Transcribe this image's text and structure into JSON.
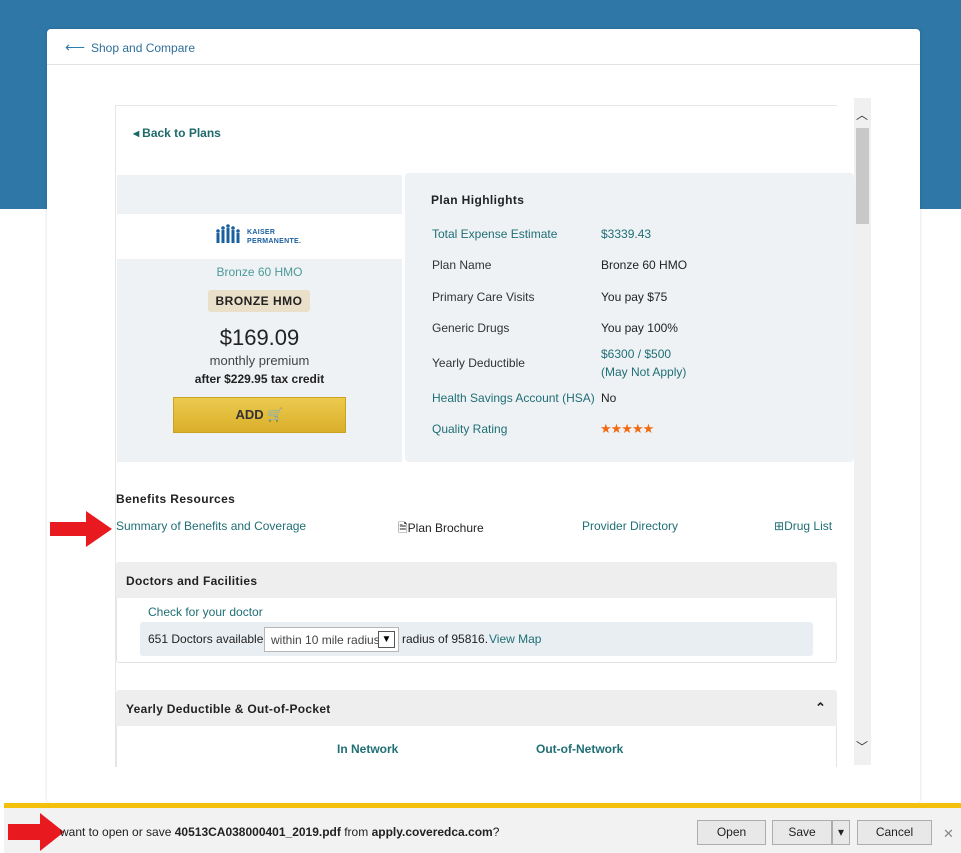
{
  "header": {
    "back_link": "Shop and Compare"
  },
  "plan": {
    "back_to_plans": "Back to Plans",
    "carrier_logo_text": "KAISER PERMANENTE",
    "carrier_logo_line1": "KAISER",
    "carrier_logo_line2": "PERMANENTE.",
    "name": "Bronze 60 HMO",
    "badge": "BRONZE HMO",
    "price": "$169.09",
    "premium_label": "monthly premium",
    "credit": "after $229.95 tax credit",
    "add_label": "ADD"
  },
  "highlights": {
    "title": "Plan Highlights",
    "rows": [
      {
        "label": "Total Expense Estimate",
        "value": "$3339.43"
      },
      {
        "label": "Plan Name",
        "value": "Bronze 60 HMO"
      },
      {
        "label": "Primary Care Visits",
        "value": "You pay $75"
      },
      {
        "label": "Generic Drugs",
        "value": "You pay 100%"
      },
      {
        "label": "Yearly Deductible",
        "value": "$6300 / $500",
        "value2": "(May Not Apply)"
      },
      {
        "label": "Health Savings Account (HSA)",
        "value": "No"
      },
      {
        "label": "Quality Rating",
        "value": "5 stars",
        "rating": 5
      }
    ]
  },
  "benefits": {
    "title": "Benefits Resources",
    "summary": "Summary of Benefits and Coverage",
    "brochure": "Plan Brochure",
    "provider": "Provider Directory",
    "drug_list": "Drug List"
  },
  "doctors": {
    "title": "Doctors and Facilities",
    "check": "Check for your doctor",
    "count": "651 Doctors available",
    "radius_select": "within 10 mile radius",
    "radius_suffix": "radius of 95816.",
    "view_map": "View Map"
  },
  "deductible": {
    "title": "Yearly Deductible & Out-of-Pocket",
    "in_network": "In Network",
    "out_network": "Out-of-Network"
  },
  "download_bar": {
    "prefix": "want to open or save",
    "filename": "40513CA038000401_2019.pdf",
    "from": "from",
    "domain": "apply.coveredca.com",
    "suffix": "?",
    "open": "Open",
    "save": "Save",
    "cancel": "Cancel"
  },
  "colors": {
    "accent_teal": "#1f6f75",
    "header_blue": "#2e77a7",
    "add_button": "#e5bd3c",
    "star_orange": "#f26a10",
    "arrow_red": "#e8191f"
  }
}
